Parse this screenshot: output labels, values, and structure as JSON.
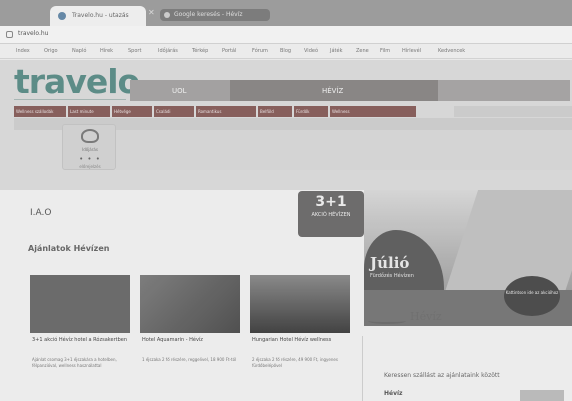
{
  "browser": {
    "active_tab": "Travelo.hu - utazás",
    "second_tab": "Google keresés - Hévíz",
    "url": "travelo.hu"
  },
  "bookmarks": [
    "Index",
    "Origo",
    "Napló",
    "Hírek",
    "Sport",
    "Időjárás",
    "Térkép",
    "Portál",
    "Fórum",
    "Blog",
    "Videó",
    "Játék",
    "Zene",
    "Film",
    "Hírlevél",
    "Kedvencek"
  ],
  "site": {
    "logo": "travelo",
    "nav": {
      "ajanlat": "UOL",
      "hotel": "HÉVÍZ"
    },
    "categories": [
      "Wellness szállodák",
      "Last minute",
      "Hétvége",
      "Családi",
      "Romantikus",
      "Belföld",
      "Fürdők",
      "Wellness"
    ],
    "weather": {
      "label": "Időjárás",
      "dots": "• • •",
      "foot": "előrejelzés"
    }
  },
  "main": {
    "heading": "I.A.O",
    "promo": {
      "big": "3+1",
      "small": "AKCIÓ HÉVÍZEN"
    },
    "hero": {
      "title": "Júlió",
      "subtitle": "Fürdőzés Hévízen",
      "circle_text": "Kattintson ide az akcióhoz"
    },
    "heviz_label": "Hévíz",
    "ajanlat_title": "Ajánlatok Hévízen",
    "offers": [
      {
        "title": "3+1 akció Hévíz hotel a Rózsakertben",
        "desc": "Ajánlat csomag 3+1 éjszakára a hotelben, félpanzióval, wellness használattal"
      },
      {
        "title": "Hotel Aquamarin - Hévíz",
        "desc": "1 éjszaka 2 fő részére, reggelivel, 18 900 Ft-tól"
      },
      {
        "title": "Hungarian Hotel Hévíz wellness",
        "desc": "2 éjszaka 2 fő részére, 49 900 Ft, ingyenes fürdőbelépővel"
      }
    ],
    "side_title": "Keressen szállást az ajánlataink között",
    "side_row": "Hévíz"
  }
}
